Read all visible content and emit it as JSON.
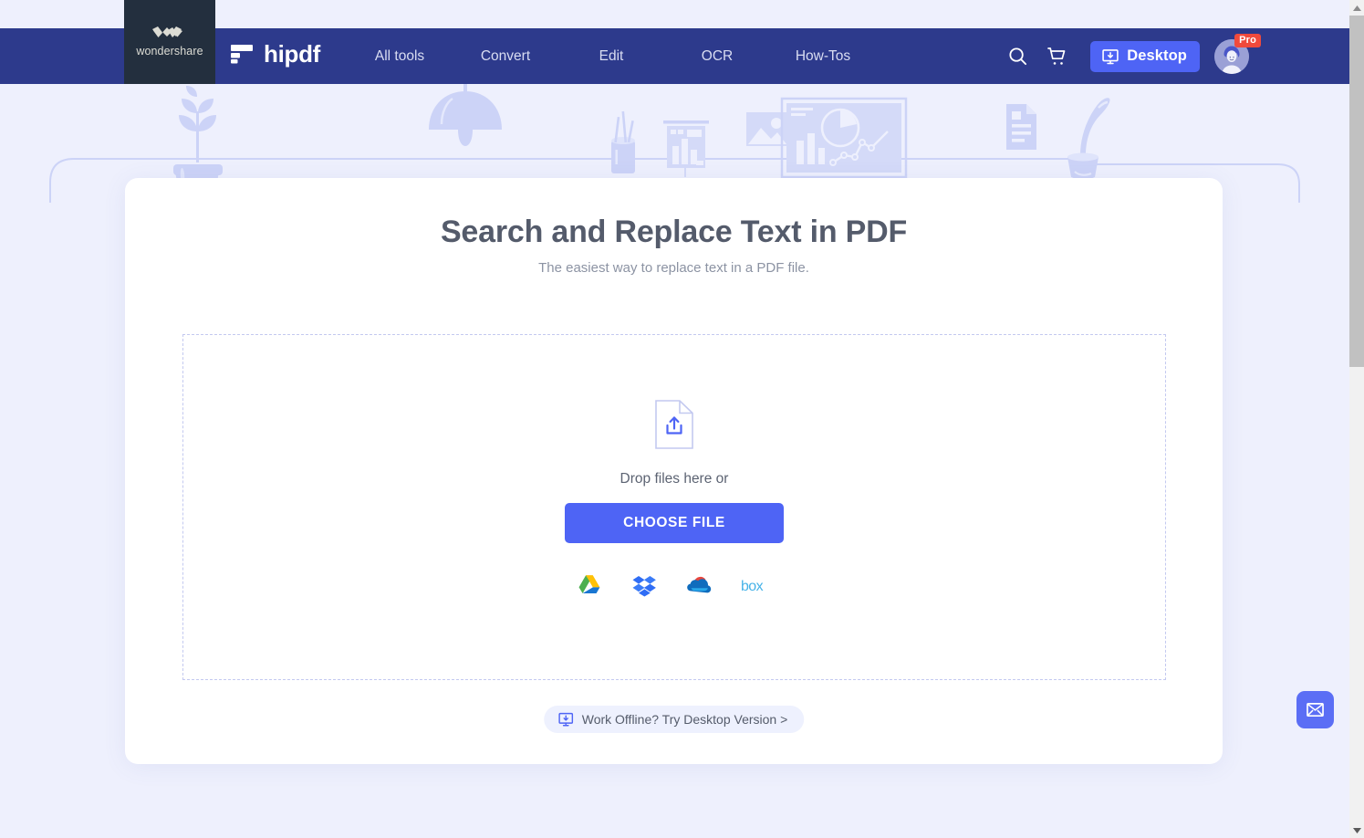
{
  "brand": {
    "wondershare_label": "wondershare",
    "product_name": "hipdf"
  },
  "nav": {
    "links": [
      {
        "label": "All tools"
      },
      {
        "label": "Convert"
      },
      {
        "label": "Edit"
      },
      {
        "label": "OCR"
      },
      {
        "label": "How-Tos"
      }
    ],
    "search_icon": "search-icon",
    "cart_icon": "cart-icon",
    "desktop_button": "Desktop",
    "account_badge": "Pro"
  },
  "main": {
    "title": "Search and Replace Text in PDF",
    "subtitle": "The easiest way to replace text in a PDF file.",
    "dropzone": {
      "upload_icon": "file-upload-icon",
      "drop_text": "Drop files here or",
      "choose_button": "CHOOSE FILE",
      "cloud_sources": [
        {
          "name": "google-drive-icon"
        },
        {
          "name": "dropbox-icon"
        },
        {
          "name": "onedrive-icon"
        },
        {
          "name": "box-icon"
        }
      ]
    },
    "offline_pill": {
      "icon": "desktop-download-icon",
      "label": "Work Offline? Try Desktop Version >"
    }
  },
  "widgets": {
    "email_icon": "envelope-icon"
  },
  "colors": {
    "navbar": "#2d3a8c",
    "wondershare_block": "#232f3e",
    "accent_blue": "#4e64f5",
    "page_bg": "#eef0fd",
    "card_bg": "#ffffff",
    "pro_badge": "#f04a3c",
    "dashed_border": "#c3c9f0",
    "heading_text": "#545b6b",
    "subtitle_text": "#8c93a3"
  }
}
